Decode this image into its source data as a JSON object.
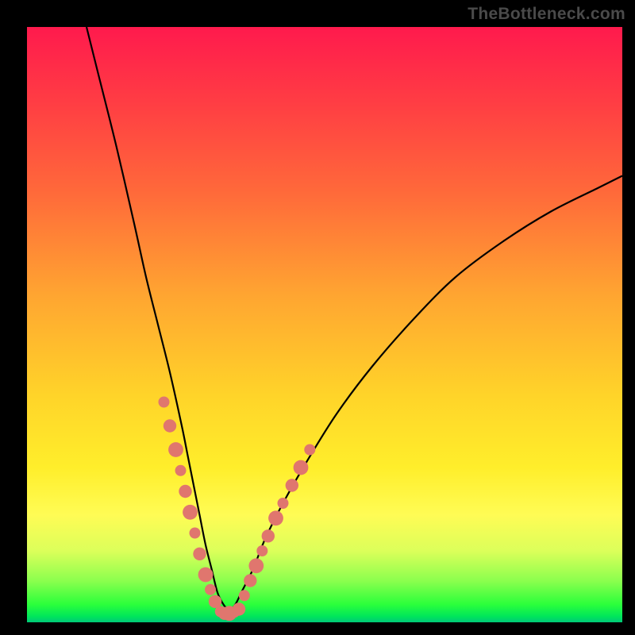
{
  "watermark": "TheBottleneck.com",
  "chart_data": {
    "type": "line",
    "title": "",
    "xlabel": "",
    "ylabel": "",
    "xlim": [
      0,
      100
    ],
    "ylim": [
      0,
      100
    ],
    "series": [
      {
        "name": "bottleneck-curve",
        "color": "#000000",
        "x": [
          10,
          12,
          15,
          18,
          20,
          22,
          24,
          26,
          27,
          28,
          29,
          30,
          31,
          32,
          33,
          34,
          35,
          36,
          38,
          40,
          43,
          47,
          52,
          58,
          65,
          72,
          80,
          88,
          96,
          100
        ],
        "y": [
          100,
          92,
          80,
          67,
          58,
          50,
          42,
          33,
          28,
          23,
          18,
          13,
          9,
          5,
          3,
          2,
          3,
          5,
          9,
          14,
          20,
          27,
          35,
          43,
          51,
          58,
          64,
          69,
          73,
          75
        ]
      },
      {
        "name": "highlighted-points-left",
        "color": "#e0766e",
        "x": [
          23.0,
          24.0,
          25.0,
          25.8,
          26.6,
          27.4,
          28.2,
          29.0,
          30.0,
          30.8,
          31.6
        ],
        "y": [
          37.0,
          33.0,
          29.0,
          25.5,
          22.0,
          18.5,
          15.0,
          11.5,
          8.0,
          5.5,
          3.5
        ]
      },
      {
        "name": "highlighted-points-bottom",
        "color": "#e0766e",
        "x": [
          32.5,
          33.2,
          34.0,
          34.8,
          35.6
        ],
        "y": [
          1.8,
          1.5,
          1.5,
          1.7,
          2.2
        ]
      },
      {
        "name": "highlighted-points-right",
        "color": "#e0766e",
        "x": [
          36.5,
          37.5,
          38.5,
          39.5,
          40.5,
          41.8,
          43.0,
          44.5,
          46.0,
          47.5
        ],
        "y": [
          4.5,
          7.0,
          9.5,
          12.0,
          14.5,
          17.5,
          20.0,
          23.0,
          26.0,
          29.0
        ]
      }
    ]
  }
}
